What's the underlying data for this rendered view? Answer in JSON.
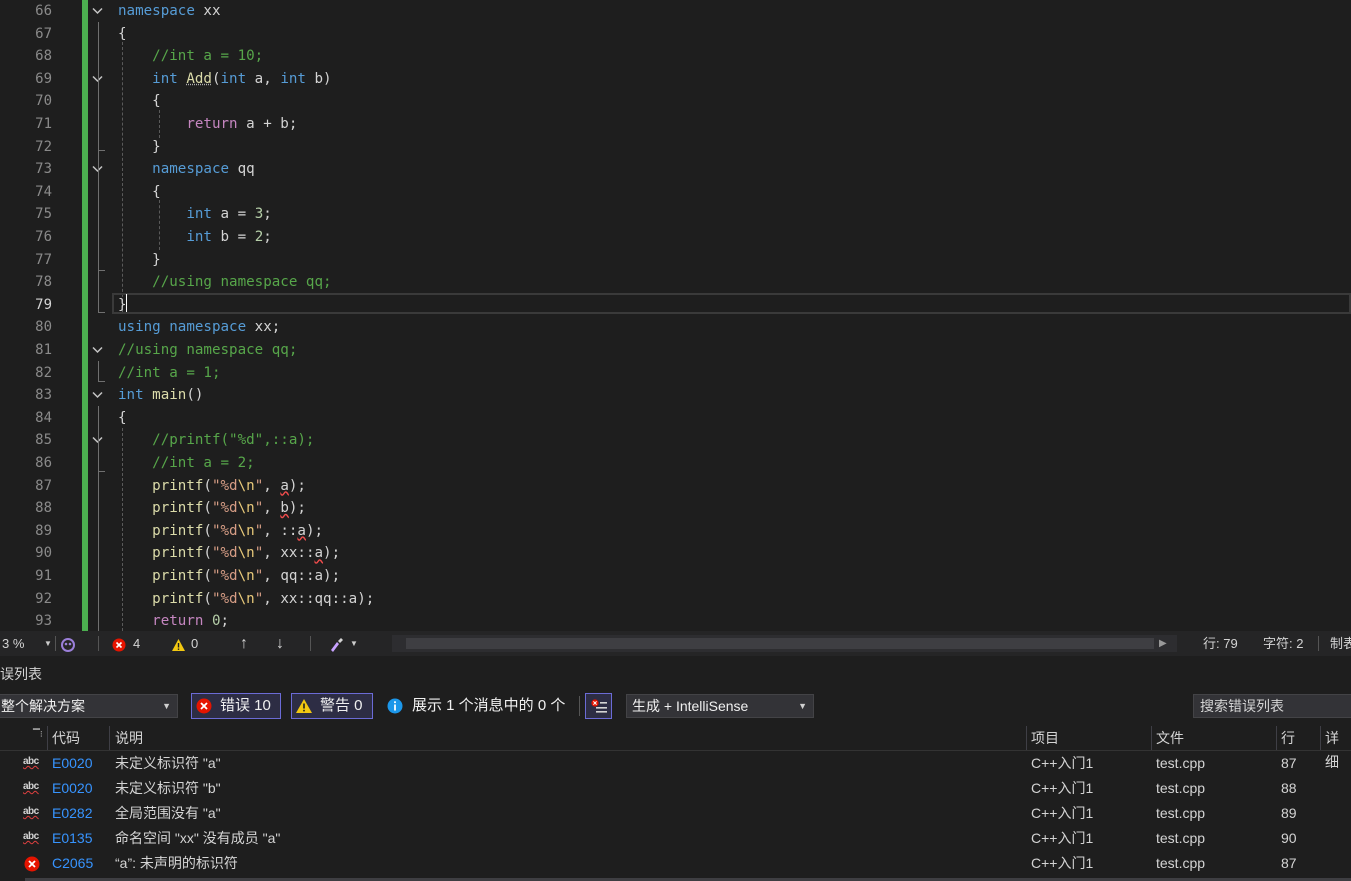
{
  "editor": {
    "lines": [
      {
        "no": "66",
        "tokens": [
          [
            "kw",
            "namespace"
          ],
          [
            "pl",
            " xx"
          ]
        ]
      },
      {
        "no": "67",
        "tokens": [
          [
            "pl",
            "{"
          ]
        ]
      },
      {
        "no": "68",
        "tokens": [
          [
            "cm",
            "    //int a = 10;"
          ]
        ]
      },
      {
        "no": "69",
        "tokens": [
          [
            "kw",
            "    int"
          ],
          [
            "pl",
            " "
          ],
          [
            "fn dots",
            "Add"
          ],
          [
            "pl",
            "("
          ],
          [
            "kw",
            "int"
          ],
          [
            "pl",
            " a, "
          ],
          [
            "kw",
            "int"
          ],
          [
            "pl",
            " b)"
          ]
        ]
      },
      {
        "no": "70",
        "tokens": [
          [
            "pl",
            "    {"
          ]
        ]
      },
      {
        "no": "71",
        "tokens": [
          [
            "kw2",
            "        return"
          ],
          [
            "pl",
            " a + b;"
          ]
        ]
      },
      {
        "no": "72",
        "tokens": [
          [
            "pl",
            "    }"
          ]
        ]
      },
      {
        "no": "73",
        "tokens": [
          [
            "kw",
            "    namespace"
          ],
          [
            "pl",
            " qq"
          ]
        ]
      },
      {
        "no": "74",
        "tokens": [
          [
            "pl",
            "    {"
          ]
        ]
      },
      {
        "no": "75",
        "tokens": [
          [
            "kw",
            "        int"
          ],
          [
            "pl",
            " a = "
          ],
          [
            "num",
            "3"
          ],
          [
            "pl",
            ";"
          ]
        ]
      },
      {
        "no": "76",
        "tokens": [
          [
            "kw",
            "        int"
          ],
          [
            "pl",
            " b = "
          ],
          [
            "num",
            "2"
          ],
          [
            "pl",
            ";"
          ]
        ]
      },
      {
        "no": "77",
        "tokens": [
          [
            "pl",
            "    }"
          ]
        ]
      },
      {
        "no": "78",
        "tokens": [
          [
            "cm",
            "    //using namespace qq;"
          ]
        ]
      },
      {
        "no": "79",
        "tokens": [
          [
            "pl",
            "}"
          ]
        ]
      },
      {
        "no": "80",
        "tokens": [
          [
            "kw",
            "using"
          ],
          [
            "pl",
            " "
          ],
          [
            "kw",
            "namespace"
          ],
          [
            "pl",
            " xx;"
          ]
        ]
      },
      {
        "no": "81",
        "tokens": [
          [
            "cm",
            "//using namespace qq;"
          ]
        ]
      },
      {
        "no": "82",
        "tokens": [
          [
            "cm",
            "//int a = 1;"
          ]
        ]
      },
      {
        "no": "83",
        "tokens": [
          [
            "kw",
            "int"
          ],
          [
            "pl",
            " "
          ],
          [
            "fn",
            "main"
          ],
          [
            "pl",
            "()"
          ]
        ]
      },
      {
        "no": "84",
        "tokens": [
          [
            "pl",
            "{"
          ]
        ]
      },
      {
        "no": "85",
        "tokens": [
          [
            "cm",
            "    //printf(\"%d\",::a);"
          ]
        ]
      },
      {
        "no": "86",
        "tokens": [
          [
            "cm",
            "    //int a = 2;"
          ]
        ]
      },
      {
        "no": "87",
        "tokens": [
          [
            "fn",
            "    printf"
          ],
          [
            "pl",
            "("
          ],
          [
            "str",
            "\"%d"
          ],
          [
            "esc",
            "\\n"
          ],
          [
            "str",
            "\""
          ],
          [
            "pl",
            ", "
          ],
          [
            "pl squig",
            "a"
          ],
          [
            "pl",
            ");"
          ]
        ]
      },
      {
        "no": "88",
        "tokens": [
          [
            "fn",
            "    printf"
          ],
          [
            "pl",
            "("
          ],
          [
            "str",
            "\"%d"
          ],
          [
            "esc",
            "\\n"
          ],
          [
            "str",
            "\""
          ],
          [
            "pl",
            ", "
          ],
          [
            "pl squig",
            "b"
          ],
          [
            "pl",
            ");"
          ]
        ]
      },
      {
        "no": "89",
        "tokens": [
          [
            "fn",
            "    printf"
          ],
          [
            "pl",
            "("
          ],
          [
            "str",
            "\"%d"
          ],
          [
            "esc",
            "\\n"
          ],
          [
            "str",
            "\""
          ],
          [
            "pl",
            ", ::"
          ],
          [
            "pl squig",
            "a"
          ],
          [
            "pl",
            ");"
          ]
        ]
      },
      {
        "no": "90",
        "tokens": [
          [
            "fn",
            "    printf"
          ],
          [
            "pl",
            "("
          ],
          [
            "str",
            "\"%d"
          ],
          [
            "esc",
            "\\n"
          ],
          [
            "str",
            "\""
          ],
          [
            "pl",
            ", xx::"
          ],
          [
            "pl squig",
            "a"
          ],
          [
            "pl",
            ");"
          ]
        ]
      },
      {
        "no": "91",
        "tokens": [
          [
            "fn",
            "    printf"
          ],
          [
            "pl",
            "("
          ],
          [
            "str",
            "\"%d"
          ],
          [
            "esc",
            "\\n"
          ],
          [
            "str",
            "\""
          ],
          [
            "pl",
            ", qq::a);"
          ]
        ]
      },
      {
        "no": "92",
        "tokens": [
          [
            "fn",
            "    printf"
          ],
          [
            "pl",
            "("
          ],
          [
            "str",
            "\"%d"
          ],
          [
            "esc",
            "\\n"
          ],
          [
            "str",
            "\""
          ],
          [
            "pl",
            ", xx::qq::a);"
          ]
        ]
      },
      {
        "no": "93",
        "tokens": [
          [
            "kw2",
            "    return"
          ],
          [
            "pl",
            " "
          ],
          [
            "num",
            "0"
          ],
          [
            "pl",
            ";"
          ]
        ]
      }
    ],
    "active_line": "79",
    "fold_lines": [
      "66",
      "69",
      "73",
      "81",
      "83",
      "85"
    ]
  },
  "statusbar": {
    "zoom": "3 %",
    "error_count": "4",
    "warning_count": "0",
    "line_label": "行: 79",
    "char_label": "字符: 2",
    "tab_label": "制表"
  },
  "error_list": {
    "title": "误列表",
    "scope": "整个解决方案",
    "errors_button": "错误 10",
    "warnings_button": "警告 0",
    "messages_text": "展示 1 个消息中的 0 个",
    "source_filter": "生成 + IntelliSense",
    "search_placeholder": "搜索错误列表",
    "headers": {
      "code": "代码",
      "desc": "说明",
      "project": "项目",
      "file": "文件",
      "line": "行",
      "detail": "详细"
    },
    "rows": [
      {
        "kind": "intellisense",
        "code": "E0020",
        "desc": "未定义标识符 \"a\"",
        "project": "C++入门1",
        "file": "test.cpp",
        "line": "87"
      },
      {
        "kind": "intellisense",
        "code": "E0020",
        "desc": "未定义标识符 \"b\"",
        "project": "C++入门1",
        "file": "test.cpp",
        "line": "88"
      },
      {
        "kind": "intellisense",
        "code": "E0282",
        "desc": "全局范围没有 \"a\"",
        "project": "C++入门1",
        "file": "test.cpp",
        "line": "89"
      },
      {
        "kind": "intellisense",
        "code": "E0135",
        "desc": "命名空间 \"xx\" 没有成员 \"a\"",
        "project": "C++入门1",
        "file": "test.cpp",
        "line": "90"
      },
      {
        "kind": "build",
        "code": "C2065",
        "desc": "“a”: 未声明的标识符",
        "project": "C++入门1",
        "file": "test.cpp",
        "line": "87"
      }
    ]
  }
}
